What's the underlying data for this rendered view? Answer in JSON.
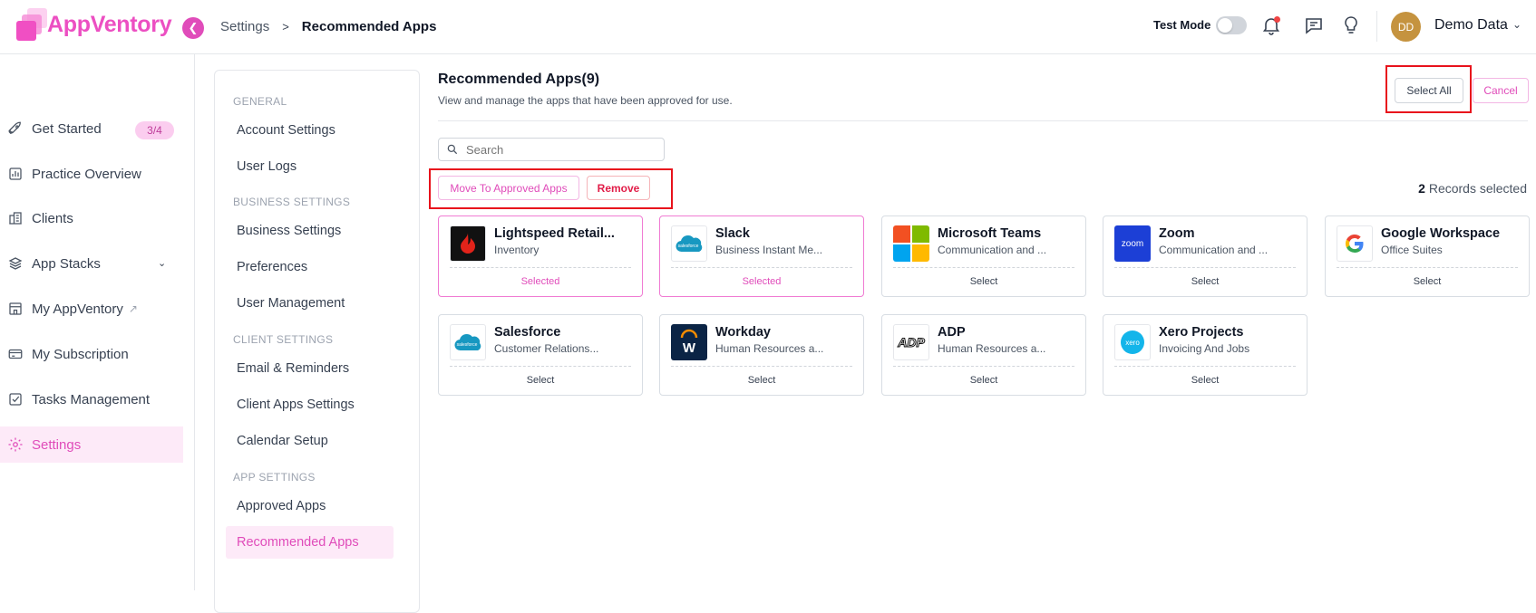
{
  "app": {
    "name": "AppVentory"
  },
  "breadcrumb": {
    "parent": "Settings",
    "separator": ">",
    "current": "Recommended Apps"
  },
  "header": {
    "test_mode_label": "Test Mode",
    "test_mode_on": false,
    "user_initials": "DD",
    "user_name": "Demo Data",
    "icons": [
      "bell-icon",
      "chat-icon",
      "lightbulb-icon"
    ]
  },
  "sidebar": {
    "items": [
      {
        "label": "Get Started",
        "icon": "rocket-icon",
        "badge": "3/4"
      },
      {
        "label": "Practice Overview",
        "icon": "chart-icon"
      },
      {
        "label": "Clients",
        "icon": "building-icon"
      },
      {
        "label": "App Stacks",
        "icon": "layers-icon"
      },
      {
        "label": "My AppVentory",
        "icon": "store-icon"
      },
      {
        "label": "My Subscription",
        "icon": "card-icon"
      },
      {
        "label": "Tasks Management",
        "icon": "checkbox-icon"
      },
      {
        "label": "Settings",
        "icon": "gear-icon"
      }
    ]
  },
  "settings_nav": {
    "sections": [
      {
        "title": "GENERAL",
        "items": [
          "Account Settings",
          "User Logs"
        ]
      },
      {
        "title": "BUSINESS SETTINGS",
        "items": [
          "Business Settings",
          "Preferences",
          "User Management"
        ]
      },
      {
        "title": "CLIENT SETTINGS",
        "items": [
          "Email & Reminders",
          "Client Apps Settings",
          "Calendar Setup"
        ]
      },
      {
        "title": "APP SETTINGS",
        "items": [
          "Approved Apps",
          "Recommended Apps"
        ]
      }
    ],
    "active": "Recommended Apps"
  },
  "main": {
    "title": "Recommended Apps(9)",
    "subtitle": "View and manage the apps that have been approved for use.",
    "select_all_label": "Select All",
    "cancel_label": "Cancel",
    "search_placeholder": "Search",
    "move_label": "Move To Approved Apps",
    "remove_label": "Remove",
    "records_count": "2",
    "records_text": "Records selected"
  },
  "apps": [
    {
      "name": "Lightspeed Retail...",
      "category": "Inventory",
      "action": "Selected",
      "selected": true,
      "logo": "lightspeed-logo"
    },
    {
      "name": "Slack",
      "category": "Business Instant Me...",
      "action": "Selected",
      "selected": true,
      "logo": "salesforce-logo"
    },
    {
      "name": "Microsoft Teams",
      "category": "Communication and ...",
      "action": "Select",
      "selected": false,
      "logo": "microsoft-logo"
    },
    {
      "name": "Zoom",
      "category": "Communication and ...",
      "action": "Select",
      "selected": false,
      "logo": "zoom-logo"
    },
    {
      "name": "Google Workspace",
      "category": "Office Suites",
      "action": "Select",
      "selected": false,
      "logo": "google-logo"
    },
    {
      "name": "Salesforce",
      "category": "Customer Relations...",
      "action": "Select",
      "selected": false,
      "logo": "salesforce-logo"
    },
    {
      "name": "Workday",
      "category": "Human Resources a...",
      "action": "Select",
      "selected": false,
      "logo": "workday-logo"
    },
    {
      "name": "ADP",
      "category": "Human Resources a...",
      "action": "Select",
      "selected": false,
      "logo": "adp-logo"
    },
    {
      "name": "Xero Projects",
      "category": "Invoicing And Jobs",
      "action": "Select",
      "selected": false,
      "logo": "xero-logo"
    }
  ]
}
